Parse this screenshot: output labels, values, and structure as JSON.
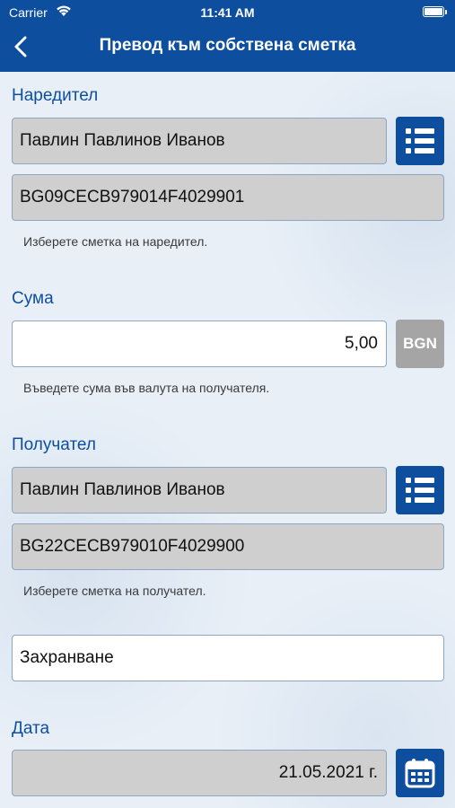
{
  "status_bar": {
    "carrier": "Carrier",
    "time": "11:41 AM"
  },
  "nav": {
    "title": "Превод към собствена сметка"
  },
  "sender": {
    "label": "Наредител",
    "name": "Павлин Павлинов Иванов",
    "iban": "BG09CECB979014F4029901",
    "hint": "Изберете сметка на наредител."
  },
  "amount": {
    "label": "Сума",
    "value": "5,00",
    "currency": "BGN",
    "hint": "Въведете сума във валута на получателя."
  },
  "recipient": {
    "label": "Получател",
    "name": "Павлин Павлинов Иванов",
    "iban": "BG22CECB979010F4029900",
    "hint": "Изберете сметка на получател."
  },
  "description": {
    "value": "Захранване"
  },
  "date": {
    "label": "Дата",
    "value": "21.05.2021 г."
  },
  "colors": {
    "primary": "#0d4f9e",
    "background": "#e8eff7",
    "field_disabled": "#cfcfcf",
    "currency_button": "#a5a5a5"
  },
  "icons": {
    "back": "chevron-left-icon",
    "list": "list-icon",
    "calendar": "calendar-icon",
    "wifi": "wifi-icon",
    "battery": "battery-icon"
  }
}
